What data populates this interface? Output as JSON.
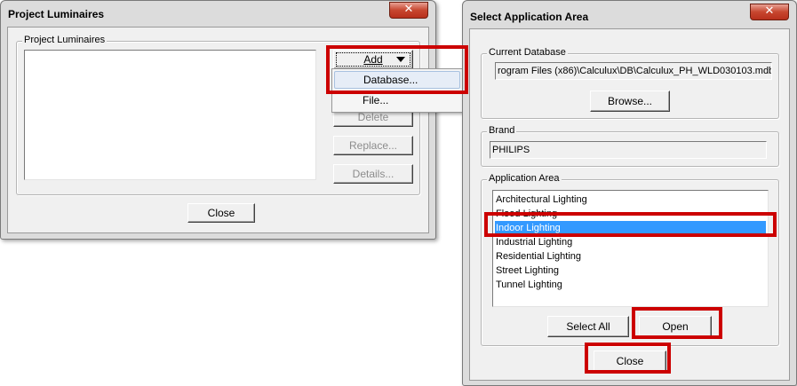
{
  "left_window": {
    "title": "Project Luminaires",
    "close_glyph": "✕",
    "group_label": "Project Luminaires",
    "add_label": "Add",
    "delete_label": "Delete",
    "replace_label": "Replace...",
    "details_label": "Details...",
    "close_label": "Close",
    "add_menu": {
      "items": [
        {
          "label": "Database..."
        },
        {
          "label": "File..."
        }
      ]
    }
  },
  "right_window": {
    "title": "Select Application Area",
    "close_glyph": "✕",
    "current_database_label": "Current Database",
    "current_database_value": "rogram Files (x86)\\Calculux\\DB\\Calculux_PH_WLD030103.mdb",
    "browse_label": "Browse...",
    "brand_label": "Brand",
    "brand_value": "PHILIPS",
    "application_area_label": "Application Area",
    "application_areas": [
      "Architectural Lighting",
      "Flood Lighting",
      "Indoor Lighting",
      "Industrial Lighting",
      "Residential Lighting",
      "Street Lighting",
      "Tunnel Lighting"
    ],
    "selected_area": "Indoor Lighting",
    "select_all_label": "Select All",
    "open_label": "Open",
    "close_label": "Close"
  },
  "colors": {
    "highlight_box": "#cc0000",
    "selection": "#3399ff",
    "close_button": "#c7462f"
  }
}
